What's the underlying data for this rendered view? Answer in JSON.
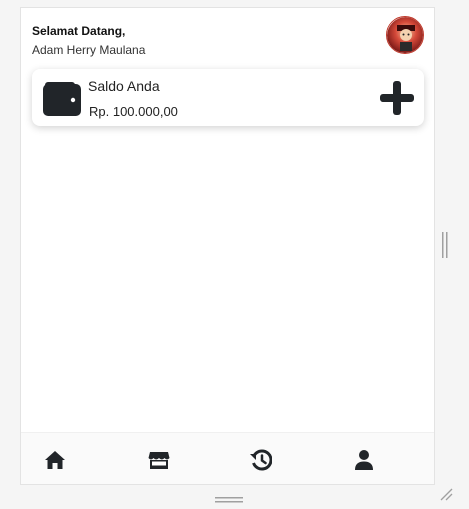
{
  "header": {
    "greeting": "Selamat Datang,",
    "user_name": "Adam Herry Maulana"
  },
  "balance_card": {
    "label": "Saldo Anda",
    "amount": "Rp. 100.000,00"
  },
  "bottom_nav": {
    "items": [
      {
        "icon": "home-icon"
      },
      {
        "icon": "store-icon"
      },
      {
        "icon": "history-icon"
      },
      {
        "icon": "user-icon"
      }
    ]
  },
  "colors": {
    "icon_dark": "#212529",
    "avatar_accent": "#c0392b"
  }
}
